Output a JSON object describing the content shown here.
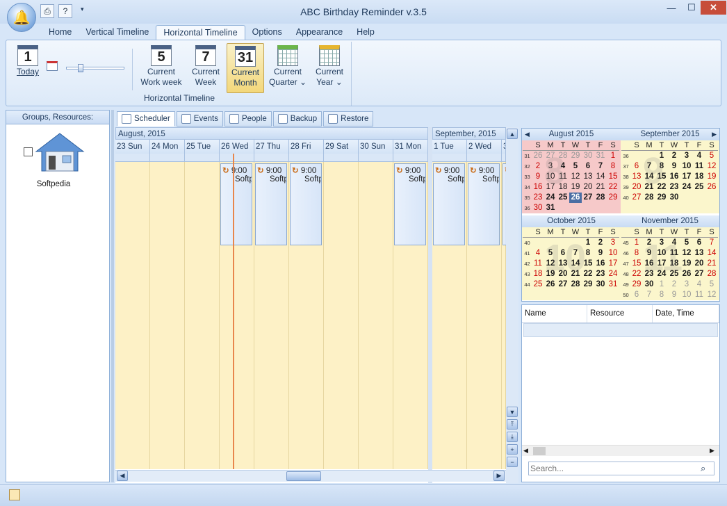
{
  "window": {
    "title": "ABC Birthday Reminder v.3.5",
    "min": "—",
    "max": "☐",
    "close": "✕"
  },
  "tabs": [
    "Home",
    "Vertical Timeline",
    "Horizontal Timeline",
    "Options",
    "Appearance",
    "Help"
  ],
  "active_tab": "Horizontal Timeline",
  "ribbon": {
    "today": {
      "num": "1",
      "label": "Today"
    },
    "buttons": [
      {
        "num": "5",
        "l1": "Current",
        "l2": "Work week"
      },
      {
        "num": "7",
        "l1": "Current",
        "l2": "Week"
      },
      {
        "num": "31",
        "l1": "Current",
        "l2": "Month"
      },
      {
        "l1": "Current",
        "l2": "Quarter ⌄"
      },
      {
        "l1": "Current",
        "l2": "Year ⌄"
      }
    ],
    "group_label": "Horizontal Timeline",
    "zoom_level": 0.2
  },
  "left_panel": {
    "header": "Groups, Resources:",
    "resource": "Softpedia"
  },
  "subtabs": [
    "Scheduler",
    "Events",
    "People",
    "Backup",
    "Restore"
  ],
  "scheduler": {
    "months": [
      "August, 2015",
      "September, 2015"
    ],
    "days_aug": [
      "23 Sun",
      "24 Mon",
      "25 Tue",
      "26 Wed",
      "27 Thu",
      "28 Fri",
      "29 Sat",
      "30 Sun",
      "31 Mon"
    ],
    "days_sep": [
      "1 Tue",
      "2 Wed",
      "3"
    ],
    "event_time": "9:00",
    "event_text": "Softpedia"
  },
  "calendars": [
    {
      "title": "August 2015",
      "weeks": [
        "31",
        "32",
        "33",
        "34",
        "35",
        "36"
      ],
      "rows": [
        [
          "26",
          "27",
          "28",
          "29",
          "30",
          "31",
          "1"
        ],
        [
          "2",
          "3",
          "4",
          "5",
          "6",
          "7",
          "8"
        ],
        [
          "9",
          "10",
          "11",
          "12",
          "13",
          "14",
          "15"
        ],
        [
          "16",
          "17",
          "18",
          "19",
          "20",
          "21",
          "22"
        ],
        [
          "23",
          "24",
          "25",
          "26",
          "27",
          "28",
          "29"
        ],
        [
          "30",
          "31",
          "",
          "",
          "",
          "",
          ""
        ]
      ]
    },
    {
      "title": "September 2015",
      "weeks": [
        "36",
        "37",
        "38",
        "39",
        "40",
        ""
      ],
      "rows": [
        [
          "",
          "",
          "1",
          "2",
          "3",
          "4",
          "5"
        ],
        [
          "6",
          "7",
          "8",
          "9",
          "10",
          "11",
          "12"
        ],
        [
          "13",
          "14",
          "15",
          "16",
          "17",
          "18",
          "19"
        ],
        [
          "20",
          "21",
          "22",
          "23",
          "24",
          "25",
          "26"
        ],
        [
          "27",
          "28",
          "29",
          "30",
          "",
          "",
          ""
        ],
        [
          "",
          "",
          "",
          "",
          "",
          "",
          ""
        ]
      ]
    },
    {
      "title": "October 2015",
      "weeks": [
        "40",
        "41",
        "42",
        "43",
        "44",
        ""
      ],
      "rows": [
        [
          "",
          "",
          "",
          "",
          "1",
          "2",
          "3"
        ],
        [
          "4",
          "5",
          "6",
          "7",
          "8",
          "9",
          "10"
        ],
        [
          "11",
          "12",
          "13",
          "14",
          "15",
          "16",
          "17"
        ],
        [
          "18",
          "19",
          "20",
          "21",
          "22",
          "23",
          "24"
        ],
        [
          "25",
          "26",
          "27",
          "28",
          "29",
          "30",
          "31"
        ],
        [
          "",
          "",
          "",
          "",
          "",
          "",
          ""
        ]
      ]
    },
    {
      "title": "November 2015",
      "weeks": [
        "45",
        "46",
        "47",
        "48",
        "49",
        "50"
      ],
      "rows": [
        [
          "1",
          "2",
          "3",
          "4",
          "5",
          "6",
          "7"
        ],
        [
          "8",
          "9",
          "10",
          "11",
          "12",
          "13",
          "14"
        ],
        [
          "15",
          "16",
          "17",
          "18",
          "19",
          "20",
          "21"
        ],
        [
          "22",
          "23",
          "24",
          "25",
          "26",
          "27",
          "28"
        ],
        [
          "29",
          "30",
          "1",
          "2",
          "3",
          "4",
          "5"
        ],
        [
          "6",
          "7",
          "8",
          "9",
          "10",
          "11",
          "12"
        ]
      ]
    }
  ],
  "dow": [
    "S",
    "M",
    "T",
    "W",
    "T",
    "F",
    "S"
  ],
  "table": {
    "cols": [
      "Name",
      "Resource",
      "Date, Time"
    ]
  },
  "search": {
    "placeholder": "Search..."
  }
}
